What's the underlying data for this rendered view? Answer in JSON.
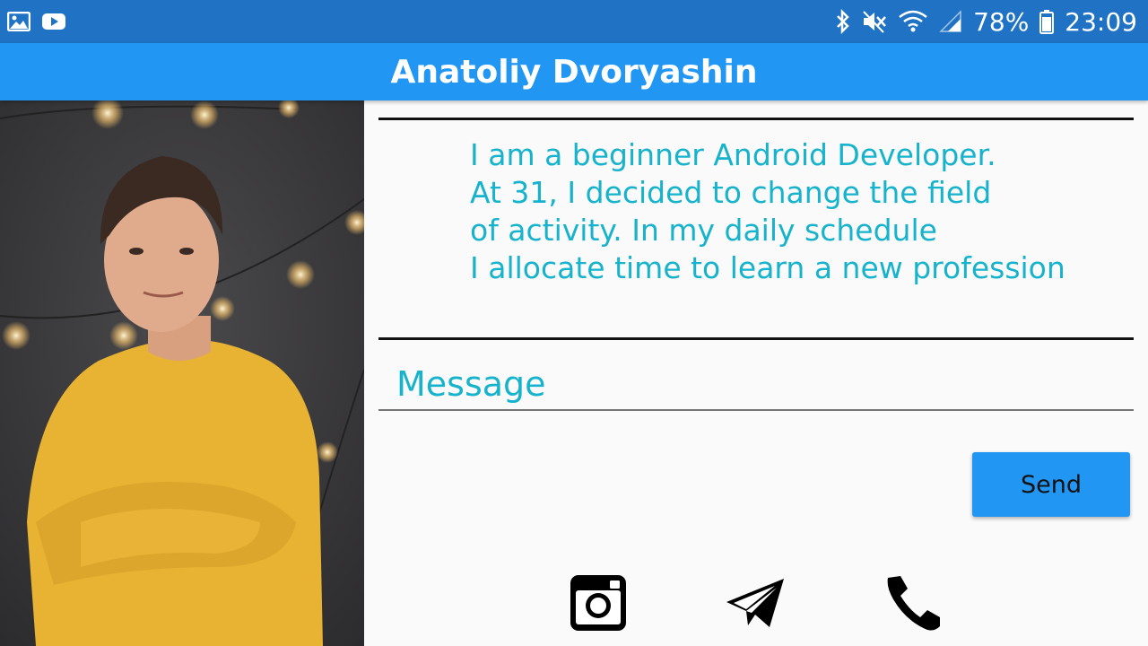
{
  "status_bar": {
    "battery": "78%",
    "time": "23:09",
    "left_icons": [
      "gallery-icon",
      "youtube-icon"
    ],
    "right_icons": [
      "bluetooth-icon",
      "mute-icon",
      "wifi-icon",
      "signal-icon",
      "battery-icon"
    ]
  },
  "app_bar": {
    "title": "Anatoliy Dvoryashin"
  },
  "profile": {
    "about_lines": [
      "I am a beginner Android Developer.",
      "At 31, I decided to change the field",
      "of activity. In my daily schedule",
      "I allocate time to learn a new profession"
    ]
  },
  "message": {
    "placeholder": "Message",
    "value": ""
  },
  "send_button": {
    "label": "Send"
  },
  "social": [
    "instagram-icon",
    "telegram-icon",
    "phone-icon"
  ],
  "colors": {
    "status_bar": "#1f72c4",
    "app_bar": "#2196f3",
    "accent_text": "#17b3cc",
    "button": "#2196f3"
  }
}
